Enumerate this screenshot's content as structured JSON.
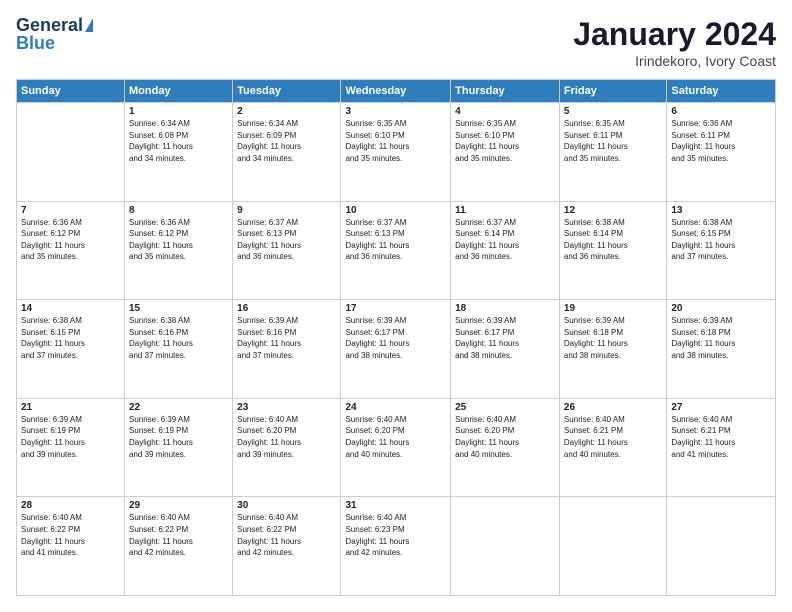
{
  "header": {
    "logo_line1": "General",
    "logo_line2": "Blue",
    "month_title": "January 2024",
    "location": "Irindekoro, Ivory Coast"
  },
  "days_of_week": [
    "Sunday",
    "Monday",
    "Tuesday",
    "Wednesday",
    "Thursday",
    "Friday",
    "Saturday"
  ],
  "weeks": [
    [
      {
        "day": "",
        "content": ""
      },
      {
        "day": "1",
        "content": "Sunrise: 6:34 AM\nSunset: 6:08 PM\nDaylight: 11 hours\nand 34 minutes."
      },
      {
        "day": "2",
        "content": "Sunrise: 6:34 AM\nSunset: 6:09 PM\nDaylight: 11 hours\nand 34 minutes."
      },
      {
        "day": "3",
        "content": "Sunrise: 6:35 AM\nSunset: 6:10 PM\nDaylight: 11 hours\nand 35 minutes."
      },
      {
        "day": "4",
        "content": "Sunrise: 6:35 AM\nSunset: 6:10 PM\nDaylight: 11 hours\nand 35 minutes."
      },
      {
        "day": "5",
        "content": "Sunrise: 6:35 AM\nSunset: 6:11 PM\nDaylight: 11 hours\nand 35 minutes."
      },
      {
        "day": "6",
        "content": "Sunrise: 6:36 AM\nSunset: 6:11 PM\nDaylight: 11 hours\nand 35 minutes."
      }
    ],
    [
      {
        "day": "7",
        "content": "Sunrise: 6:36 AM\nSunset: 6:12 PM\nDaylight: 11 hours\nand 35 minutes."
      },
      {
        "day": "8",
        "content": "Sunrise: 6:36 AM\nSunset: 6:12 PM\nDaylight: 11 hours\nand 35 minutes."
      },
      {
        "day": "9",
        "content": "Sunrise: 6:37 AM\nSunset: 6:13 PM\nDaylight: 11 hours\nand 36 minutes."
      },
      {
        "day": "10",
        "content": "Sunrise: 6:37 AM\nSunset: 6:13 PM\nDaylight: 11 hours\nand 36 minutes."
      },
      {
        "day": "11",
        "content": "Sunrise: 6:37 AM\nSunset: 6:14 PM\nDaylight: 11 hours\nand 36 minutes."
      },
      {
        "day": "12",
        "content": "Sunrise: 6:38 AM\nSunset: 6:14 PM\nDaylight: 11 hours\nand 36 minutes."
      },
      {
        "day": "13",
        "content": "Sunrise: 6:38 AM\nSunset: 6:15 PM\nDaylight: 11 hours\nand 37 minutes."
      }
    ],
    [
      {
        "day": "14",
        "content": "Sunrise: 6:38 AM\nSunset: 6:15 PM\nDaylight: 11 hours\nand 37 minutes."
      },
      {
        "day": "15",
        "content": "Sunrise: 6:38 AM\nSunset: 6:16 PM\nDaylight: 11 hours\nand 37 minutes."
      },
      {
        "day": "16",
        "content": "Sunrise: 6:39 AM\nSunset: 6:16 PM\nDaylight: 11 hours\nand 37 minutes."
      },
      {
        "day": "17",
        "content": "Sunrise: 6:39 AM\nSunset: 6:17 PM\nDaylight: 11 hours\nand 38 minutes."
      },
      {
        "day": "18",
        "content": "Sunrise: 6:39 AM\nSunset: 6:17 PM\nDaylight: 11 hours\nand 38 minutes."
      },
      {
        "day": "19",
        "content": "Sunrise: 6:39 AM\nSunset: 6:18 PM\nDaylight: 11 hours\nand 38 minutes."
      },
      {
        "day": "20",
        "content": "Sunrise: 6:39 AM\nSunset: 6:18 PM\nDaylight: 11 hours\nand 38 minutes."
      }
    ],
    [
      {
        "day": "21",
        "content": "Sunrise: 6:39 AM\nSunset: 6:19 PM\nDaylight: 11 hours\nand 39 minutes."
      },
      {
        "day": "22",
        "content": "Sunrise: 6:39 AM\nSunset: 6:19 PM\nDaylight: 11 hours\nand 39 minutes."
      },
      {
        "day": "23",
        "content": "Sunrise: 6:40 AM\nSunset: 6:20 PM\nDaylight: 11 hours\nand 39 minutes."
      },
      {
        "day": "24",
        "content": "Sunrise: 6:40 AM\nSunset: 6:20 PM\nDaylight: 11 hours\nand 40 minutes."
      },
      {
        "day": "25",
        "content": "Sunrise: 6:40 AM\nSunset: 6:20 PM\nDaylight: 11 hours\nand 40 minutes."
      },
      {
        "day": "26",
        "content": "Sunrise: 6:40 AM\nSunset: 6:21 PM\nDaylight: 11 hours\nand 40 minutes."
      },
      {
        "day": "27",
        "content": "Sunrise: 6:40 AM\nSunset: 6:21 PM\nDaylight: 11 hours\nand 41 minutes."
      }
    ],
    [
      {
        "day": "28",
        "content": "Sunrise: 6:40 AM\nSunset: 6:22 PM\nDaylight: 11 hours\nand 41 minutes."
      },
      {
        "day": "29",
        "content": "Sunrise: 6:40 AM\nSunset: 6:22 PM\nDaylight: 11 hours\nand 42 minutes."
      },
      {
        "day": "30",
        "content": "Sunrise: 6:40 AM\nSunset: 6:22 PM\nDaylight: 11 hours\nand 42 minutes."
      },
      {
        "day": "31",
        "content": "Sunrise: 6:40 AM\nSunset: 6:23 PM\nDaylight: 11 hours\nand 42 minutes."
      },
      {
        "day": "",
        "content": ""
      },
      {
        "day": "",
        "content": ""
      },
      {
        "day": "",
        "content": ""
      }
    ]
  ]
}
